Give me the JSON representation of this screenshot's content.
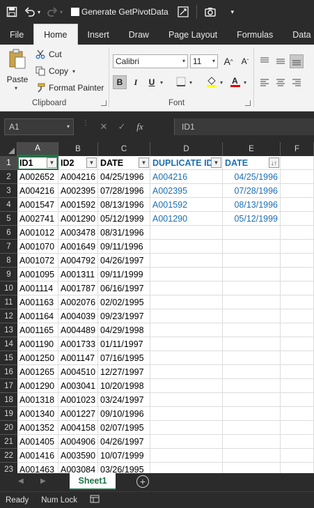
{
  "qat": {
    "generate_label": "Generate GetPivotData"
  },
  "tabs": [
    "File",
    "Home",
    "Insert",
    "Draw",
    "Page Layout",
    "Formulas",
    "Data"
  ],
  "active_tab": "Home",
  "ribbon": {
    "paste_label": "Paste",
    "cut_label": "Cut",
    "copy_label": "Copy",
    "format_painter_label": "Format Painter",
    "clipboard_group": "Clipboard",
    "font_name": "Calibri",
    "font_size": "11",
    "font_group": "Font",
    "bold": "B",
    "italic": "I",
    "underline": "U"
  },
  "formula_bar": {
    "name_box": "A1",
    "fx": "fx",
    "content": "ID1"
  },
  "columns": [
    "A",
    "B",
    "C",
    "D",
    "E",
    "F"
  ],
  "selected_column": "A",
  "header_row": {
    "a": "ID1",
    "b": "ID2",
    "c": "DATE",
    "d": "DUPLICATE ID",
    "e": "DATE"
  },
  "rows": [
    {
      "n": "2",
      "a": "A002652",
      "b": "A004216",
      "c": "04/25/1996",
      "d": "A004216",
      "e": "04/25/1996"
    },
    {
      "n": "3",
      "a": "A004216",
      "b": "A002395",
      "c": "07/28/1996",
      "d": "A002395",
      "e": "07/28/1996"
    },
    {
      "n": "4",
      "a": "A001547",
      "b": "A001592",
      "c": "08/13/1996",
      "d": "A001592",
      "e": "08/13/1996"
    },
    {
      "n": "5",
      "a": "A002741",
      "b": "A001290",
      "c": "05/12/1999",
      "d": "A001290",
      "e": "05/12/1999"
    },
    {
      "n": "6",
      "a": "A001012",
      "b": "A003478",
      "c": "08/31/1996",
      "d": "",
      "e": ""
    },
    {
      "n": "7",
      "a": "A001070",
      "b": "A001649",
      "c": "09/11/1996",
      "d": "",
      "e": ""
    },
    {
      "n": "8",
      "a": "A001072",
      "b": "A004792",
      "c": "04/26/1997",
      "d": "",
      "e": ""
    },
    {
      "n": "9",
      "a": "A001095",
      "b": "A001311",
      "c": "09/11/1999",
      "d": "",
      "e": ""
    },
    {
      "n": "10",
      "a": "A001114",
      "b": "A001787",
      "c": "06/16/1997",
      "d": "",
      "e": ""
    },
    {
      "n": "11",
      "a": "A001163",
      "b": "A002076",
      "c": "02/02/1995",
      "d": "",
      "e": ""
    },
    {
      "n": "12",
      "a": "A001164",
      "b": "A004039",
      "c": "09/23/1997",
      "d": "",
      "e": ""
    },
    {
      "n": "13",
      "a": "A001165",
      "b": "A004489",
      "c": "04/29/1998",
      "d": "",
      "e": ""
    },
    {
      "n": "14",
      "a": "A001190",
      "b": "A001733",
      "c": "01/11/1997",
      "d": "",
      "e": ""
    },
    {
      "n": "15",
      "a": "A001250",
      "b": "A001147",
      "c": "07/16/1995",
      "d": "",
      "e": ""
    },
    {
      "n": "16",
      "a": "A001265",
      "b": "A004510",
      "c": "12/27/1997",
      "d": "",
      "e": ""
    },
    {
      "n": "17",
      "a": "A001290",
      "b": "A003041",
      "c": "10/20/1998",
      "d": "",
      "e": ""
    },
    {
      "n": "18",
      "a": "A001318",
      "b": "A001023",
      "c": "03/24/1997",
      "d": "",
      "e": ""
    },
    {
      "n": "19",
      "a": "A001340",
      "b": "A001227",
      "c": "09/10/1996",
      "d": "",
      "e": ""
    },
    {
      "n": "20",
      "a": "A001352",
      "b": "A004158",
      "c": "02/07/1995",
      "d": "",
      "e": ""
    },
    {
      "n": "21",
      "a": "A001405",
      "b": "A004906",
      "c": "04/26/1997",
      "d": "",
      "e": ""
    },
    {
      "n": "22",
      "a": "A001416",
      "b": "A003590",
      "c": "10/07/1999",
      "d": "",
      "e": ""
    },
    {
      "n": "23",
      "a": "A001463",
      "b": "A003084",
      "c": "03/26/1995",
      "d": "",
      "e": ""
    }
  ],
  "sheet_tab": "Sheet1",
  "status": {
    "ready": "Ready",
    "num_lock": "Num Lock"
  },
  "colors": {
    "accent": "#217346",
    "blue_text": "#1f6fb2",
    "dark_chrome": "#2b2b2b"
  }
}
